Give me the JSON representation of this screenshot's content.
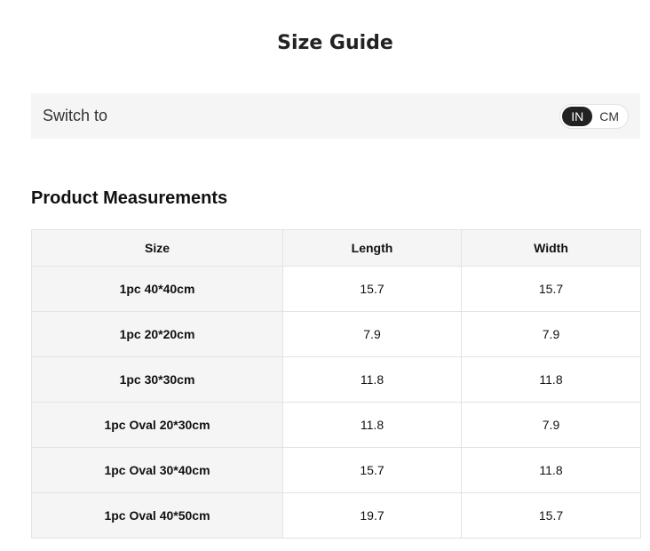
{
  "title": "Size Guide",
  "switch": {
    "label": "Switch to",
    "options": [
      "IN",
      "CM"
    ],
    "selected": "IN"
  },
  "section_title": "Product Measurements",
  "table": {
    "headers": [
      "Size",
      "Length",
      "Width"
    ],
    "rows": [
      {
        "size": "1pc 40*40cm",
        "length": "15.7",
        "width": "15.7"
      },
      {
        "size": "1pc 20*20cm",
        "length": "7.9",
        "width": "7.9"
      },
      {
        "size": "1pc 30*30cm",
        "length": "11.8",
        "width": "11.8"
      },
      {
        "size": "1pc Oval 20*30cm",
        "length": "11.8",
        "width": "7.9"
      },
      {
        "size": "1pc Oval 30*40cm",
        "length": "15.7",
        "width": "11.8"
      },
      {
        "size": "1pc Oval 40*50cm",
        "length": "19.7",
        "width": "15.7"
      }
    ]
  },
  "colors": {
    "toggle_active": "#222222",
    "panel_bg": "#f5f5f5"
  }
}
